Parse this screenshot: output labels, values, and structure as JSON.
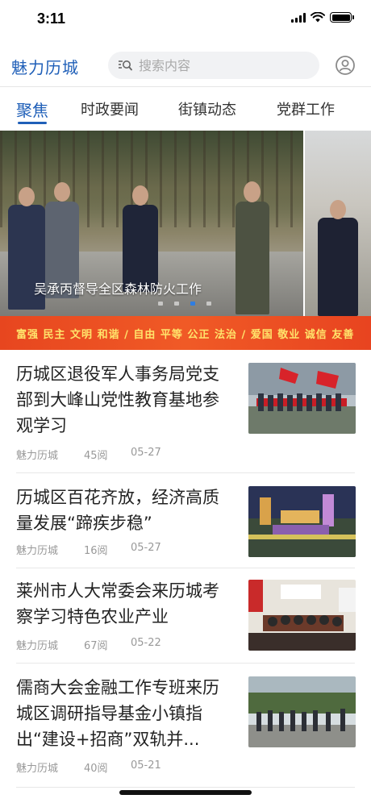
{
  "status_bar": {
    "time": "3:11"
  },
  "header": {
    "logo": "魅力历城",
    "search_placeholder": "搜索内容"
  },
  "tabs": [
    {
      "label": "聚焦",
      "active": true
    },
    {
      "label": "时政要闻",
      "active": false
    },
    {
      "label": "街镇动态",
      "active": false
    },
    {
      "label": "党群工作",
      "active": false
    }
  ],
  "carousel": {
    "caption": "吴承丙督导全区森林防火工作",
    "dot_count": 4,
    "active_index": 2
  },
  "values_banner": "富强 民主 文明 和谐 / 自由 平等 公正 法治 / 爱国 敬业 诚信 友善",
  "news": [
    {
      "title": "历城区退役军人事务局党支部到大峰山党性教育基地参观学习",
      "source": "魅力历城",
      "reads": "45阅",
      "date": "05-27",
      "thumb": "flag-group-photo"
    },
    {
      "title": "历城区百花齐放，经济高质量发展“蹄疾步稳”",
      "source": "魅力历城",
      "reads": "16阅",
      "date": "05-27",
      "thumb": "city-night-rendering"
    },
    {
      "title": "莱州市人大常委会来历城考察学习特色农业产业",
      "source": "魅力历城",
      "reads": "67阅",
      "date": "05-22",
      "thumb": "meeting-room"
    },
    {
      "title": "儒商大会金融工作专班来历城区调研指导基金小镇指出“建设+招商”双轨并...",
      "source": "魅力历城",
      "reads": "40阅",
      "date": "05-21",
      "thumb": "outdoor-visit"
    }
  ],
  "colors": {
    "accent": "#1f5fb8",
    "banner": "#e8461f"
  }
}
